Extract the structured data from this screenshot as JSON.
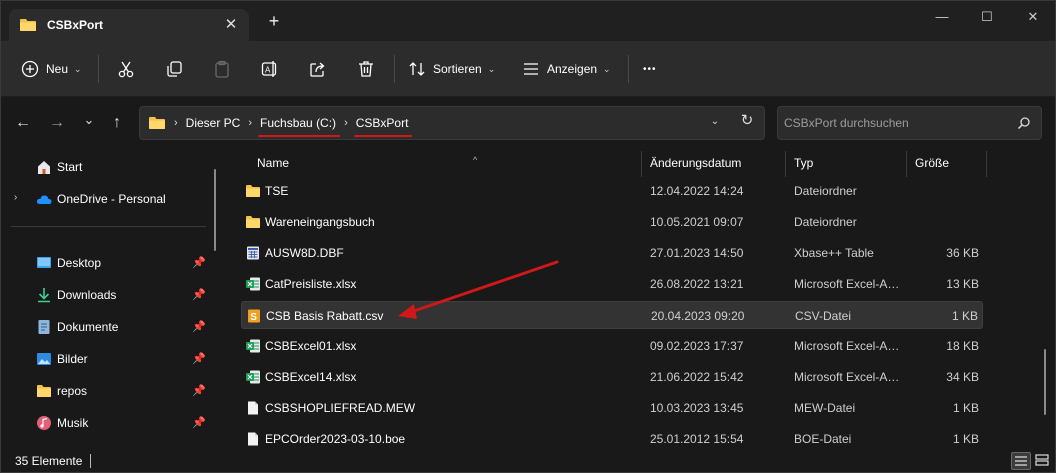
{
  "window": {
    "tab_title": "CSBxPort",
    "tab_close": "✕",
    "new_tab": "+",
    "minimize": "—",
    "maximize": "☐",
    "close": "✕"
  },
  "toolbar": {
    "new_label": "Neu",
    "sort_label": "Sortieren",
    "view_label": "Anzeigen",
    "more_label": "•••",
    "icons": [
      "plus-circle-icon",
      "cut-icon",
      "copy-icon",
      "paste-icon",
      "rename-icon",
      "share-icon",
      "delete-icon",
      "sort-icon",
      "view-icon",
      "more-icon"
    ]
  },
  "navigation": {
    "back": "←",
    "forward": "→",
    "recent": "⌄",
    "up": "↑",
    "breadcrumbs": [
      "Dieser PC",
      "Fuchsbau (C:)",
      "CSBxPort"
    ],
    "breadcrumb_separator": "›",
    "dropdown": "⌄",
    "refresh": "↻",
    "search_placeholder": "CSBxPort durchsuchen"
  },
  "sidebar": {
    "items": [
      {
        "label": "Start",
        "icon": "home-icon",
        "pinned": false
      },
      {
        "label": "OneDrive - Personal",
        "icon": "cloud-icon",
        "expander": "›",
        "pinned": false
      },
      {
        "label": "Desktop",
        "icon": "desktop-icon",
        "pinned": true
      },
      {
        "label": "Downloads",
        "icon": "download-icon",
        "pinned": true
      },
      {
        "label": "Dokumente",
        "icon": "documents-icon",
        "pinned": true
      },
      {
        "label": "Bilder",
        "icon": "pictures-icon",
        "pinned": true
      },
      {
        "label": "repos",
        "icon": "folder-icon",
        "pinned": true
      },
      {
        "label": "Musik",
        "icon": "music-icon",
        "pinned": true
      }
    ],
    "pin_glyph": "📌"
  },
  "columns": {
    "name": "Name",
    "date": "Änderungsdatum",
    "type": "Typ",
    "size": "Größe",
    "sort_indicator": "^"
  },
  "files": [
    {
      "name": "TSE",
      "date": "12.04.2022 14:24",
      "type": "Dateiordner",
      "size": "",
      "icon": "folder-icon"
    },
    {
      "name": "Wareneingangsbuch",
      "date": "10.05.2021 09:07",
      "type": "Dateiordner",
      "size": "",
      "icon": "folder-icon"
    },
    {
      "name": "AUSW8D.DBF",
      "date": "27.01.2023 14:50",
      "type": "Xbase++ Table",
      "size": "36 KB",
      "icon": "dbf-icon"
    },
    {
      "name": "CatPreisliste.xlsx",
      "date": "26.08.2022 13:21",
      "type": "Microsoft Excel-Arbeitsblatt",
      "size": "13 KB",
      "icon": "excel-icon"
    },
    {
      "name": "CSB Basis Rabatt.csv",
      "date": "20.04.2023 09:20",
      "type": "CSV-Datei",
      "size": "1 KB",
      "icon": "csv-icon",
      "selected": true
    },
    {
      "name": "CSBExcel01.xlsx",
      "date": "09.02.2023 17:37",
      "type": "Microsoft Excel-Arbeitsblatt",
      "size": "18 KB",
      "icon": "excel-icon"
    },
    {
      "name": "CSBExcel14.xlsx",
      "date": "21.06.2022 15:42",
      "type": "Microsoft Excel-Arbeitsblatt",
      "size": "34 KB",
      "icon": "excel-icon"
    },
    {
      "name": "CSBSHOPLIEFREAD.MEW",
      "date": "10.03.2023 13:45",
      "type": "MEW-Datei",
      "size": "1 KB",
      "icon": "file-icon"
    },
    {
      "name": "EPCOrder2023-03-10.boe",
      "date": "25.01.2012 15:54",
      "type": "BOE-Datei",
      "size": "1 KB",
      "icon": "file-icon"
    }
  ],
  "status": {
    "item_count": "35 Elemente"
  },
  "colors": {
    "accent": "#0078d4",
    "annotation_red": "#d01818",
    "folder": "#f2c14e",
    "excel": "#1d9f5a"
  }
}
